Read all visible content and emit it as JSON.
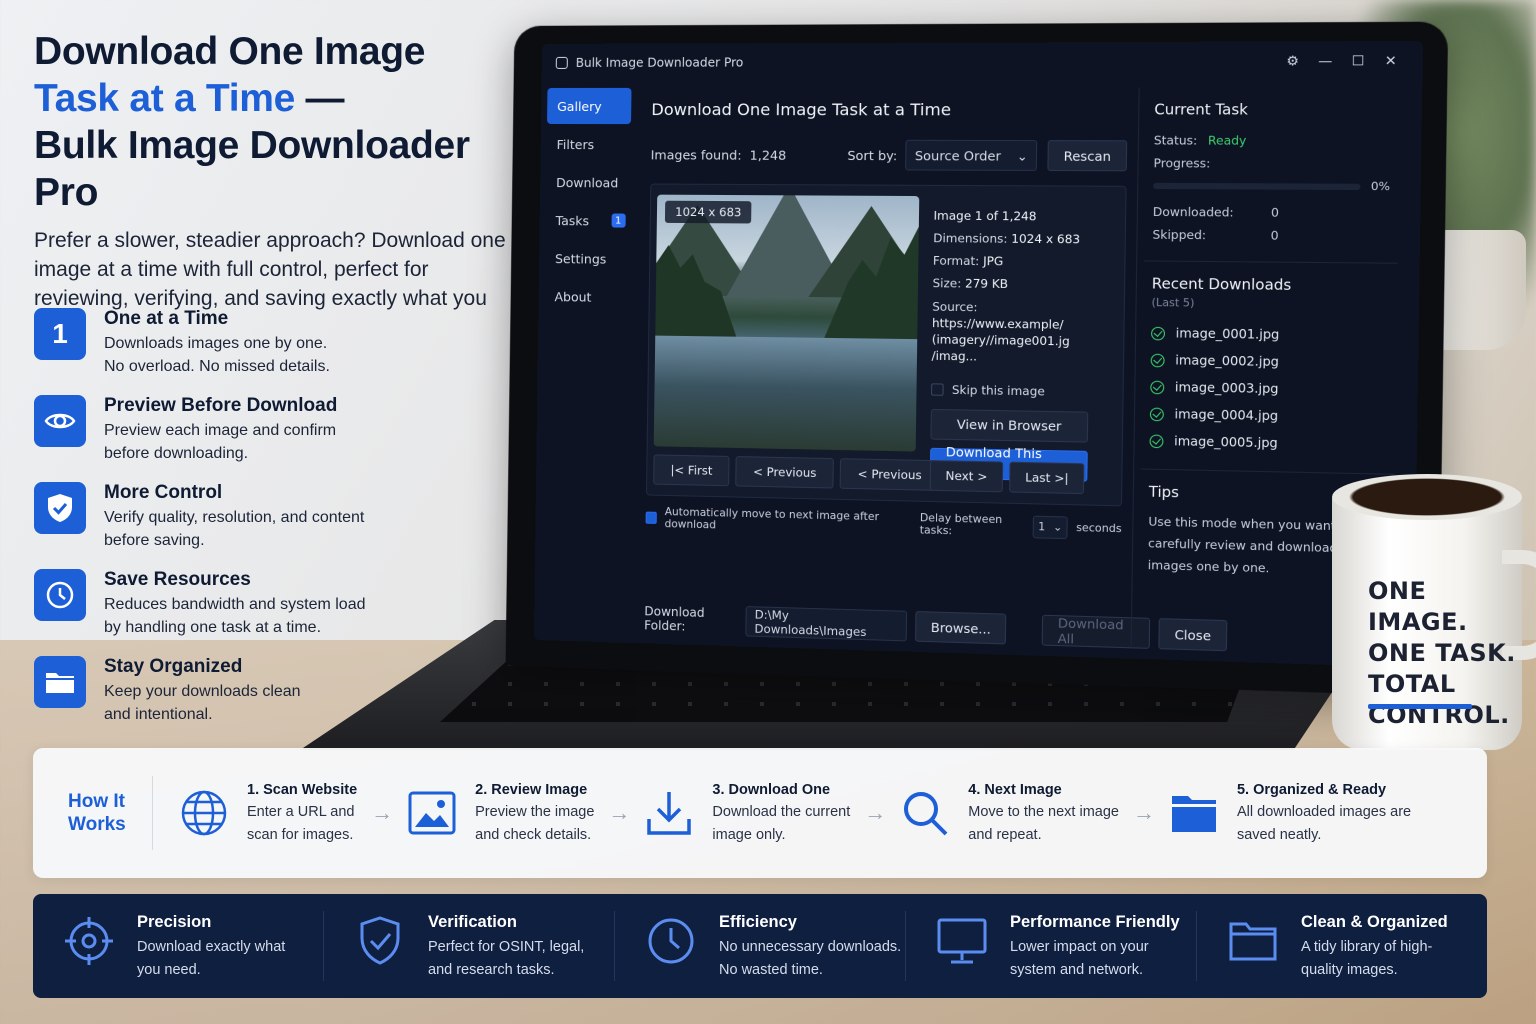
{
  "hero": {
    "title_line1": "Download One Image",
    "title_line2_accent": "Task at a Time",
    "title_line2_rest": " —",
    "title_line3": "Bulk Image Downloader Pro",
    "subtitle": "Prefer a slower, steadier approach? Download one image at a time with full control, perfect for reviewing, verifying, and saving exactly what you need."
  },
  "features": [
    {
      "icon": "number-one",
      "icon_text": "1",
      "title": "One at a Time",
      "desc_line1": "Downloads images one by one.",
      "desc_line2": "No overload. No missed details."
    },
    {
      "icon": "eye-icon",
      "title": "Preview Before Download",
      "desc_line1": "Preview each image and confirm",
      "desc_line2": "before downloading."
    },
    {
      "icon": "shield-check-icon",
      "title": "More Control",
      "desc_line1": "Verify quality, resolution, and content",
      "desc_line2": "before saving."
    },
    {
      "icon": "clock-icon",
      "title": "Save Resources",
      "desc_line1": "Reduces bandwidth and system load",
      "desc_line2": "by handling one task at a time."
    },
    {
      "icon": "folder-icon",
      "title": "Stay Organized",
      "desc_line1": "Keep your downloads clean",
      "desc_line2": "and intentional."
    }
  ],
  "app": {
    "window_title": "Bulk Image Downloader Pro",
    "sidebar": [
      {
        "label": "Gallery",
        "active": true
      },
      {
        "label": "Filters"
      },
      {
        "label": "Download"
      },
      {
        "label": "Tasks",
        "badge": "1"
      },
      {
        "label": "Settings"
      },
      {
        "label": "About"
      }
    ],
    "main_title": "Download One Image Task at a Time",
    "images_found_label": "Images found:",
    "images_found_value": "1,248",
    "sort_label": "Sort by:",
    "sort_value": "Source Order",
    "rescan": "Rescan",
    "dimension_badge": "1024 x 683",
    "image_counter": "Image 1 of 1,248",
    "dimensions_label": "Dimensions:",
    "dimensions_value": "1024 x 683",
    "format_label": "Format:",
    "format_value": "JPG",
    "size_label": "Size:",
    "size_value": "279 KB",
    "source_label": "Source:",
    "source_value": "https://www.example/ (imagery//image001.jg /imag...",
    "skip": "Skip this image",
    "view_browser": "View in Browser",
    "download_this": "Download This Image",
    "nav": {
      "first": "|< First",
      "previous1": "< Previous",
      "previous2": "< Previous",
      "next": "Next >",
      "last": "Last >|"
    },
    "auto_move": "Automatically move to next image after download",
    "delay_label": "Delay between tasks:",
    "delay_value": "1",
    "delay_unit": "seconds",
    "folder_label": "Download Folder:",
    "folder_value": "D:\\My Downloads\\Images",
    "browse": "Browse...",
    "download_all": "Download All",
    "close": "Close",
    "current_task": {
      "title": "Current Task",
      "status_label": "Status:",
      "status_value": "Ready",
      "progress_label": "Progress:",
      "progress_pct": "0%",
      "progress": 0,
      "downloaded_label": "Downloaded:",
      "downloaded_value": "0",
      "skipped_label": "Skipped:",
      "skipped_value": "0"
    },
    "recent": {
      "title": "Recent Downloads",
      "subtitle": "(Last 5)",
      "items": [
        "image_0001.jpg",
        "image_0002.jpg",
        "image_0003.jpg",
        "image_0004.jpg",
        "image_0005.jpg"
      ]
    },
    "tips": {
      "title": "Tips",
      "text": "Use this mode when you want to carefully review and download images one by one."
    }
  },
  "mug": {
    "line1": "ONE IMAGE.",
    "line2": "ONE TASK.",
    "line3": "TOTAL",
    "line4": "CONTROL."
  },
  "how": {
    "label_line1": "How It",
    "label_line2": "Works",
    "steps": [
      {
        "icon": "globe-icon",
        "title": "1. Scan Website",
        "desc_line1": "Enter a URL and",
        "desc_line2": "scan for images."
      },
      {
        "icon": "image-icon",
        "title": "2. Review Image",
        "desc_line1": "Preview the image",
        "desc_line2": "and check details."
      },
      {
        "icon": "download-icon",
        "title": "3. Download One",
        "desc_line1": "Download the current",
        "desc_line2": "image only."
      },
      {
        "icon": "search-icon",
        "title": "4. Next Image",
        "desc_line1": "Move to the next image",
        "desc_line2": "and repeat."
      },
      {
        "icon": "folder-icon",
        "title": "5. Organized & Ready",
        "desc_line1": "All downloaded images are",
        "desc_line2": "saved neatly."
      }
    ]
  },
  "benefits": [
    {
      "icon": "crosshair-icon",
      "title": "Precision",
      "desc_line1": "Download exactly what",
      "desc_line2": "you need."
    },
    {
      "icon": "shield-check-icon",
      "title": "Verification",
      "desc_line1": "Perfect for OSINT, legal,",
      "desc_line2": "and research tasks."
    },
    {
      "icon": "clock-icon",
      "title": "Efficiency",
      "desc_line1": "No unnecessary downloads.",
      "desc_line2": "No wasted time."
    },
    {
      "icon": "monitor-icon",
      "title": "Performance Friendly",
      "desc_line1": "Lower impact on your",
      "desc_line2": "system and network."
    },
    {
      "icon": "folder-icon",
      "title": "Clean & Organized",
      "desc_line1": "A tidy library of high-",
      "desc_line2": "quality images."
    }
  ],
  "colors": {
    "accent": "#1d5fd6",
    "dark_navy": "#0f1f40",
    "ready_green": "#3ecf6e"
  }
}
